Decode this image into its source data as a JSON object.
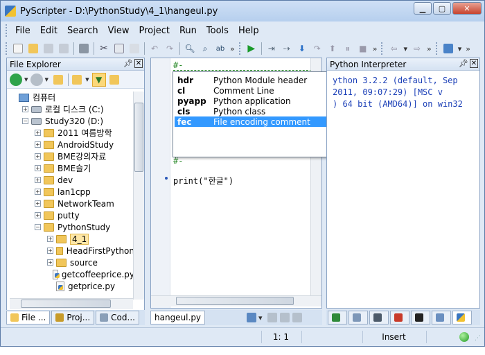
{
  "window": {
    "title": "PyScripter - D:\\PythonStudy\\4_1\\hangeul.py"
  },
  "menu": [
    "File",
    "Edit",
    "Search",
    "View",
    "Project",
    "Run",
    "Tools",
    "Help"
  ],
  "file_explorer": {
    "title": "File Explorer",
    "tree": [
      {
        "label": "컴퓨터",
        "indent": 0,
        "icon": "computer-icon",
        "toggle": ""
      },
      {
        "label": "로컬 디스크 (C:)",
        "indent": 1,
        "icon": "drive-icon",
        "toggle": "+"
      },
      {
        "label": "Study320 (D:)",
        "indent": 1,
        "icon": "drive-icon",
        "toggle": "-"
      },
      {
        "label": "2011 여름방학",
        "indent": 2,
        "icon": "folder-icon",
        "toggle": "+"
      },
      {
        "label": "AndroidStudy",
        "indent": 2,
        "icon": "folder-icon",
        "toggle": "+"
      },
      {
        "label": "BME강의자료",
        "indent": 2,
        "icon": "folder-icon",
        "toggle": "+"
      },
      {
        "label": "BME슬기",
        "indent": 2,
        "icon": "folder-icon",
        "toggle": "+"
      },
      {
        "label": "dev",
        "indent": 2,
        "icon": "folder-icon",
        "toggle": "+"
      },
      {
        "label": "lan1cpp",
        "indent": 2,
        "icon": "folder-icon",
        "toggle": "+"
      },
      {
        "label": "NetworkTeam",
        "indent": 2,
        "icon": "folder-icon",
        "toggle": "+"
      },
      {
        "label": "putty",
        "indent": 2,
        "icon": "folder-icon",
        "toggle": "+"
      },
      {
        "label": "PythonStudy",
        "indent": 2,
        "icon": "folder-icon",
        "toggle": "-"
      },
      {
        "label": "4_1",
        "indent": 3,
        "icon": "folder-icon",
        "toggle": "+",
        "selected": true
      },
      {
        "label": "HeadFirstPython",
        "indent": 3,
        "icon": "folder-icon",
        "toggle": "+"
      },
      {
        "label": "source",
        "indent": 3,
        "icon": "folder-icon",
        "toggle": "+"
      },
      {
        "label": "getcoffeeprice.py",
        "indent": 3,
        "icon": "python-file-icon",
        "toggle": ""
      },
      {
        "label": "getprice.py",
        "indent": 3,
        "icon": "python-file-icon",
        "toggle": ""
      }
    ]
  },
  "left_tabs": [
    "File ...",
    "Proj...",
    "Cod..."
  ],
  "editor": {
    "code_line_1": "#-",
    "code_line_2": "#-",
    "code_line_3": "print(\"한글\")",
    "tab_label": "hangeul.py"
  },
  "completion_popup": [
    {
      "key": "hdr",
      "desc": "Python Module header"
    },
    {
      "key": "cl",
      "desc": "Comment Line"
    },
    {
      "key": "pyapp",
      "desc": "Python application"
    },
    {
      "key": "cls",
      "desc": "Python class"
    },
    {
      "key": "fec",
      "desc": "File encoding comment",
      "selected": true
    }
  ],
  "interpreter": {
    "title": "Python Interpreter",
    "lines": [
      "ython 3.2.2 (default, Sep",
      "2011, 09:07:29) [MSC v",
      ") 64 bit (AMD64)] on win32"
    ]
  },
  "status": {
    "position": "1:  1",
    "mode": "Insert"
  },
  "colors": {
    "accent": "#3399ff",
    "interp_text": "#1b3fb7"
  }
}
